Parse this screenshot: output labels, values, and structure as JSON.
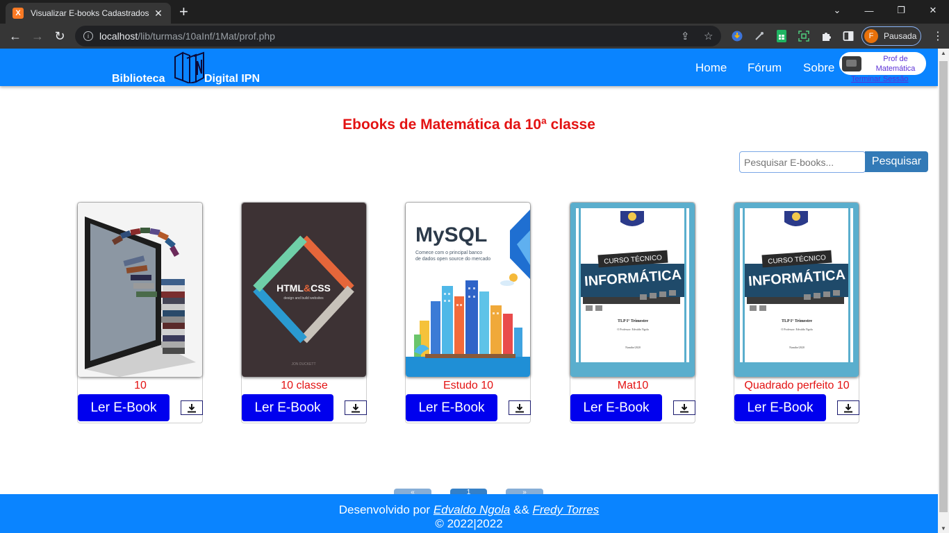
{
  "browser": {
    "tab_title": "Visualizar E-books Cadastrados",
    "favicon_glyph": "X",
    "url_host": "localhost",
    "url_path": "/lib/turmas/10aInf/1Mat/prof.php",
    "profile_initial": "F",
    "profile_status": "Pausada"
  },
  "site": {
    "brand_left": "Biblioteca",
    "brand_right": "Digital IPN",
    "nav": [
      "Home",
      "Fórum",
      "Sobre"
    ],
    "user_name": "Prof de Matemática",
    "logout_label": "Terminar Sessão",
    "colors": {
      "primary": "#0a84ff",
      "heading": "#e31212",
      "button": "#0000ee"
    }
  },
  "main": {
    "heading": "Ebooks de Matemática da 10ª classe",
    "search": {
      "placeholder": "Pesquisar E-books...",
      "button_label": "Pesquisar"
    },
    "ebooks": [
      {
        "title": "10",
        "read_label": "Ler E-Book",
        "cover": "laptop-books"
      },
      {
        "title": "10 classe",
        "read_label": "Ler E-Book",
        "cover": "html-css"
      },
      {
        "title": "Estudo 10",
        "read_label": "Ler E-Book",
        "cover": "mysql"
      },
      {
        "title": "Mat10",
        "read_label": "Ler E-Book",
        "cover": "curso-informatica"
      },
      {
        "title": "Quadrado perfeito 10",
        "read_label": "Ler E-Book",
        "cover": "curso-informatica"
      }
    ],
    "pagination": [
      "«",
      "1",
      "»"
    ]
  },
  "covers": {
    "html_css_title_a": "HTML",
    "html_css_title_amp": "&",
    "html_css_title_b": "CSS",
    "html_css_subtitle": "design and build websites",
    "html_css_author": "JON DUCKETT",
    "mysql_title": "MySQL",
    "mysql_sub1": "Comece com o principal banco",
    "mysql_sub2": "de dados open source do mercado",
    "curso_label": "CURSO TÉCNICO",
    "informatica_label": "INFORMÁTICA",
    "curso_line1": "TLP I° Trimestre",
    "curso_line2": "O Professor: Edvaldo Ngola",
    "curso_line3": "Namibe/2020"
  },
  "footer": {
    "credits_prefix": "Desenvolvido por ",
    "author1": "Edvaldo Ngola",
    "credits_joiner": " && ",
    "author2": "Fredy Torres",
    "copyright": "© 2022|2022"
  }
}
